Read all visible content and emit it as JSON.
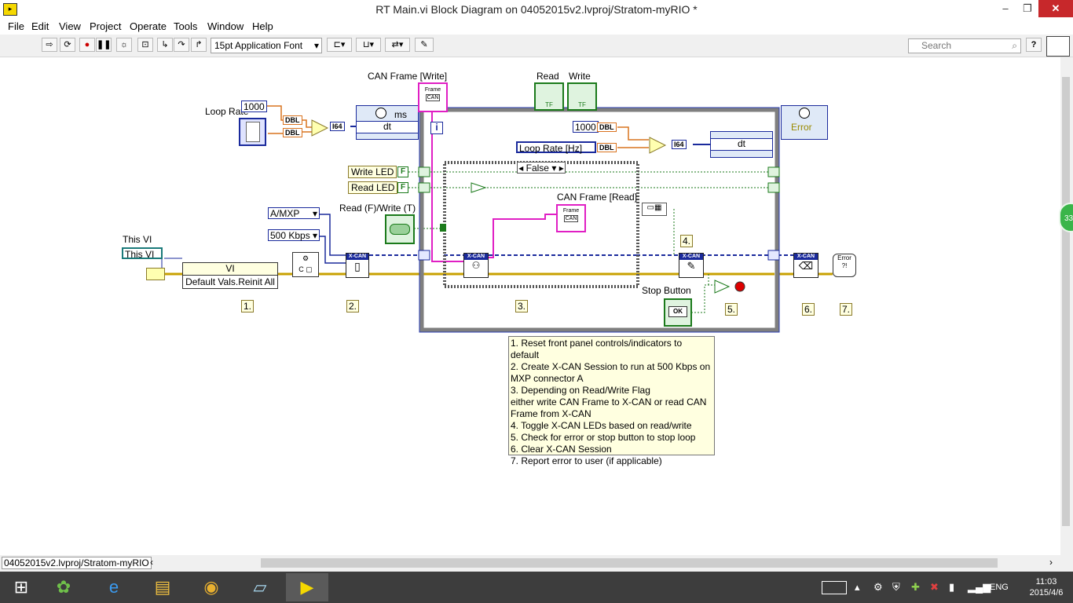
{
  "window": {
    "title": "RT Main.vi Block Diagram on 04052015v2.lvproj/Stratom-myRIO *",
    "controls": {
      "minimize": "‒",
      "restore": "❐",
      "close": "✕"
    }
  },
  "menu": [
    "File",
    "Edit",
    "View",
    "Project",
    "Operate",
    "Tools",
    "Window",
    "Help"
  ],
  "toolbar": {
    "font_select": "15pt Application Font",
    "search_placeholder": "Search",
    "help": "?"
  },
  "diagram": {
    "labels": {
      "loop_rate": "Loop Rate",
      "can_frame_write": "CAN Frame [Write]",
      "read": "Read",
      "write": "Write",
      "this_vi": "This VI",
      "read_write": "Read (F)/Write (T)",
      "can_frame_read": "CAN Frame [Read]",
      "stop_button": "Stop Button"
    },
    "constants": {
      "c1000_a": "1000",
      "c1000_b": "1000",
      "mxp": "A/MXP",
      "baud": "500 Kbps",
      "this_vi_ref": "This VI",
      "loop_rate_hz": "Loop Rate [Hz]"
    },
    "types": {
      "dbl": "DBL",
      "i64": "I64"
    },
    "timers": {
      "ms": "ms",
      "dt_a": "dt",
      "dt_b": "dt",
      "error": "Error"
    },
    "invoke": {
      "vi": "VI",
      "method": "Default Vals.Reinit All"
    },
    "case": {
      "selector": "False"
    },
    "leds": {
      "write": "Write LED",
      "read": "Read LED",
      "f": "F"
    },
    "iteration": "i",
    "xcan": "X-CAN",
    "frame": "Frame",
    "can": "CAN",
    "ok": "OK",
    "tf": "TF",
    "steps": [
      "1.",
      "2.",
      "3.",
      "4.",
      "5.",
      "6.",
      "7."
    ],
    "comment": [
      "1. Reset front panel controls/indicators to default",
      "2. Create X-CAN Session to run at 500 Kbps on",
      "MXP connector A",
      "3. Depending on Read/Write Flag",
      "either write CAN Frame to X-CAN or read CAN",
      "Frame from X-CAN",
      "4. Toggle X-CAN LEDs based on read/write",
      "5. Check for error or stop button to stop loop",
      "6. Clear X-CAN Session",
      "7. Report error to user (if applicable)"
    ],
    "error_icon": "Error"
  },
  "status": {
    "path": "04052015v2.lvproj/Stratom-myRIO"
  },
  "badge": "33",
  "taskbar": {
    "lang": "ENG",
    "time": "11:03",
    "date": "2015/4/6"
  },
  "colors": {
    "wire_error": "#c8a000",
    "wire_can": "#e01fc4",
    "wire_blue": "#1a2a9c",
    "wire_bool": "#1b7a1b",
    "wire_dbl": "#d9731f",
    "loop_border": "#7f7f7f",
    "comment_bg": "#ffffe0"
  }
}
